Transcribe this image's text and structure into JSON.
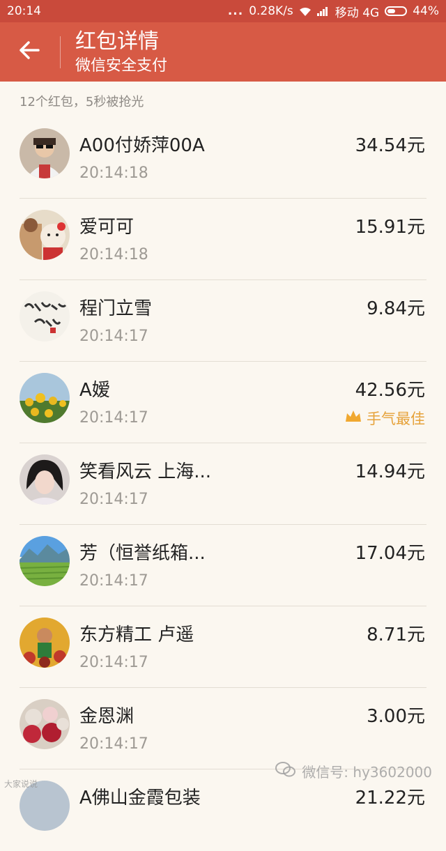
{
  "status_bar": {
    "time": "20:14",
    "dots": "...",
    "speed": "0.28K/s",
    "carrier": "移动 4G",
    "battery": "44%",
    "battery_level": 0.44
  },
  "header": {
    "title": "红包详情",
    "subtitle": "微信安全支付"
  },
  "summary": "12个红包，5秒被抢光",
  "items": [
    {
      "name": "A00付娇萍00A",
      "time": "20:14:18",
      "amount": "34.54元"
    },
    {
      "name": "爱可可",
      "time": "20:14:18",
      "amount": "15.91元"
    },
    {
      "name": "程门立雪",
      "time": "20:14:17",
      "amount": "9.84元"
    },
    {
      "name": "A嫒",
      "time": "20:14:17",
      "amount": "42.56元",
      "best_label": "手气最佳"
    },
    {
      "name": "笑看风云  上海...",
      "time": "20:14:17",
      "amount": "14.94元"
    },
    {
      "name": "芳（恒誉纸箱...",
      "time": "20:14:17",
      "amount": "17.04元"
    },
    {
      "name": "东方精工 卢遥",
      "time": "20:14:17",
      "amount": "8.71元"
    },
    {
      "name": "金恩渊",
      "time": "20:14:17",
      "amount": "3.00元"
    },
    {
      "name": "A佛山金霞包装",
      "time": "",
      "amount": "21.22元"
    }
  ],
  "watermark": {
    "text": "微信号: hy3602000",
    "left_text": "大家说说"
  },
  "colors": {
    "status_bar": "#c94a3b",
    "header": "#d75a45",
    "background": "#fbf7f0",
    "best": "#e6a23a"
  }
}
